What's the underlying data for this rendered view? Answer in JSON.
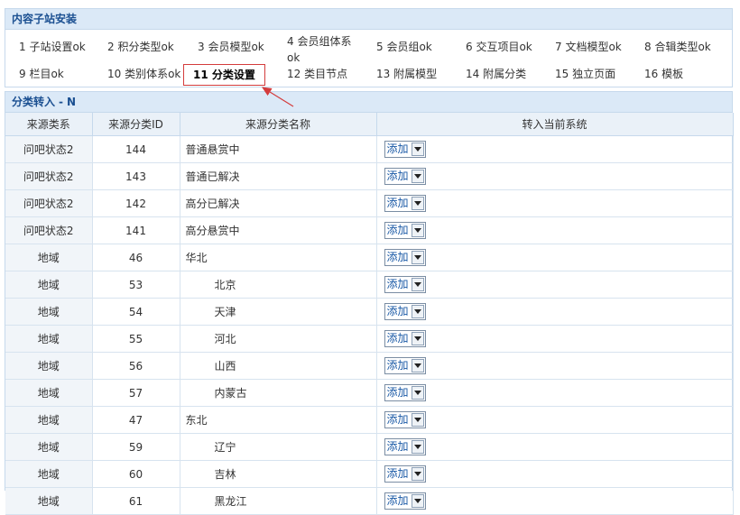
{
  "install": {
    "title": "内容子站安装",
    "steps": [
      {
        "label": "1 子站设置ok"
      },
      {
        "label": "2 积分类型ok"
      },
      {
        "label": "3 会员模型ok"
      },
      {
        "label": "4 会员组体系ok"
      },
      {
        "label": "5 会员组ok"
      },
      {
        "label": "6 交互项目ok"
      },
      {
        "label": "7 文档模型ok"
      },
      {
        "label": "8 合辑类型ok"
      },
      {
        "label": "9 栏目ok"
      },
      {
        "label": "10 类别体系ok"
      },
      {
        "label": "11 分类设置",
        "active": true
      },
      {
        "label": "12 类目节点"
      },
      {
        "label": "13 附属模型"
      },
      {
        "label": "14 附属分类"
      },
      {
        "label": "15 独立页面"
      },
      {
        "label": "16 模板"
      }
    ]
  },
  "convert": {
    "title": "分类转入",
    "dash": "-",
    "flag": "N",
    "columns": [
      "来源类系",
      "来源分类ID",
      "来源分类名称",
      "转入当前系统"
    ],
    "select_value": "添加",
    "rows": [
      {
        "source": "问吧状态2",
        "id": "144",
        "name": "普通悬赏中",
        "child": false
      },
      {
        "source": "问吧状态2",
        "id": "143",
        "name": "普通已解决",
        "child": false
      },
      {
        "source": "问吧状态2",
        "id": "142",
        "name": "高分已解决",
        "child": false
      },
      {
        "source": "问吧状态2",
        "id": "141",
        "name": "高分悬赏中",
        "child": false
      },
      {
        "source": "地域",
        "id": "46",
        "name": "华北",
        "child": false
      },
      {
        "source": "地域",
        "id": "53",
        "name": "北京",
        "child": true
      },
      {
        "source": "地域",
        "id": "54",
        "name": "天津",
        "child": true
      },
      {
        "source": "地域",
        "id": "55",
        "name": "河北",
        "child": true
      },
      {
        "source": "地域",
        "id": "56",
        "name": "山西",
        "child": true
      },
      {
        "source": "地域",
        "id": "57",
        "name": "内蒙古",
        "child": true
      },
      {
        "source": "地域",
        "id": "47",
        "name": "东北",
        "child": false
      },
      {
        "source": "地域",
        "id": "59",
        "name": "辽宁",
        "child": true
      },
      {
        "source": "地域",
        "id": "60",
        "name": "吉林",
        "child": true
      },
      {
        "source": "地域",
        "id": "61",
        "name": "黑龙江",
        "child": true
      }
    ]
  },
  "colors": {
    "annotation_arrow": "#d43c3c",
    "header_bg": "#dbe9f7",
    "header_text": "#1a4f91"
  }
}
